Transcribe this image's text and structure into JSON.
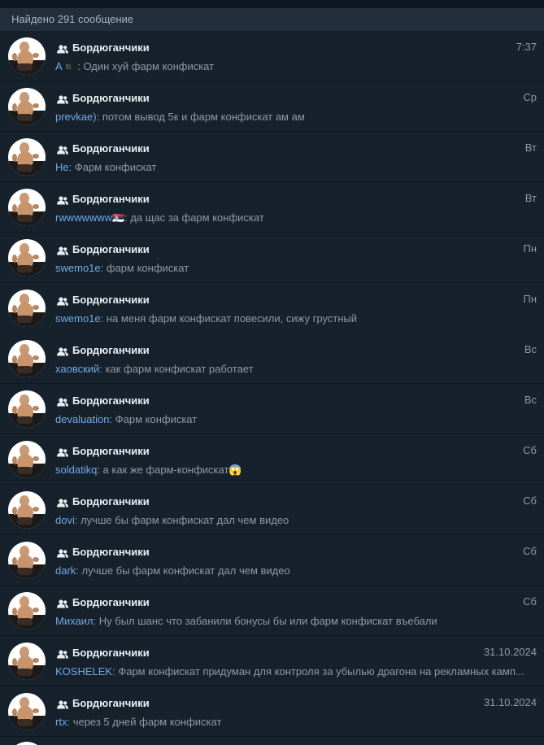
{
  "header": {
    "results_label": "Найдено 291 сообщение"
  },
  "colors": {
    "background": "#17212b",
    "header_bg": "#232e3c",
    "sender": "#71aae8",
    "title": "#e9eef3",
    "muted": "#8d9aa8"
  },
  "icons": {
    "group": "group-icon",
    "avatar": "avatar"
  },
  "results": [
    {
      "chat": "Бордюганчики",
      "date": "7:37",
      "sender": "A",
      "emoji": "◾",
      "sep": " : ",
      "text": "Один хуй фарм конфискат"
    },
    {
      "chat": "Бордюганчики",
      "date": "Ср",
      "sender": "prevkae)",
      "emoji": "",
      "sep": ": ",
      "text": "потом вывод 5к и фарм конфискат ам ам"
    },
    {
      "chat": "Бордюганчики",
      "date": "Вт",
      "sender": "He",
      "emoji": "",
      "sep": ": ",
      "text": "Фарм конфискат"
    },
    {
      "chat": "Бордюганчики",
      "date": "Вт",
      "sender": "rwwwwwww",
      "emoji": "🇷🇸",
      "sep": ": ",
      "text": "да щас за фарм конфискат"
    },
    {
      "chat": "Бордюганчики",
      "date": "Пн",
      "sender": "swemo1e",
      "emoji": "",
      "sep": ": ",
      "text": "фарм конфискат"
    },
    {
      "chat": "Бордюганчики",
      "date": "Пн",
      "sender": "swemo1e",
      "emoji": "",
      "sep": ": ",
      "text": "на меня фарм конфискат повесили, сижу грустный"
    },
    {
      "chat": "Бордюганчики",
      "date": "Вс",
      "sender": "хаовский",
      "emoji": "",
      "sep": ": ",
      "text": "как фарм  конфискат работает"
    },
    {
      "chat": "Бордюганчики",
      "date": "Вс",
      "sender": "devaluation",
      "emoji": "",
      "sep": ": ",
      "text": "Фарм конфискат"
    },
    {
      "chat": "Бордюганчики",
      "date": "Сб",
      "sender": "soldatikq",
      "emoji": "",
      "sep": ": ",
      "text": "а как же фарм-конфискат😱"
    },
    {
      "chat": "Бордюганчики",
      "date": "Сб",
      "sender": "dovi",
      "emoji": "",
      "sep": ": ",
      "text": "лучше бы фарм конфискат дал чем видео"
    },
    {
      "chat": "Бордюганчики",
      "date": "Сб",
      "sender": "dark",
      "emoji": "",
      "sep": ": ",
      "text": "лучше бы фарм конфискат дал чем видео"
    },
    {
      "chat": "Бордюганчики",
      "date": "Сб",
      "sender": "Михаил",
      "emoji": "",
      "sep": ": ",
      "text": "Ну был шанс что забанили бонусы бы или фарм конфискат въебали"
    },
    {
      "chat": "Бордюганчики",
      "date": "31.10.2024",
      "sender": "KOSHELEK",
      "emoji": "",
      "sep": ": ",
      "text": "Фарм конфискат придуман для контроля за убылью драгона на рекламных камп..."
    },
    {
      "chat": "Бордюганчики",
      "date": "31.10.2024",
      "sender": "rtx",
      "emoji": "",
      "sep": ": ",
      "text": "через 5 дней фарм конфискат"
    }
  ]
}
